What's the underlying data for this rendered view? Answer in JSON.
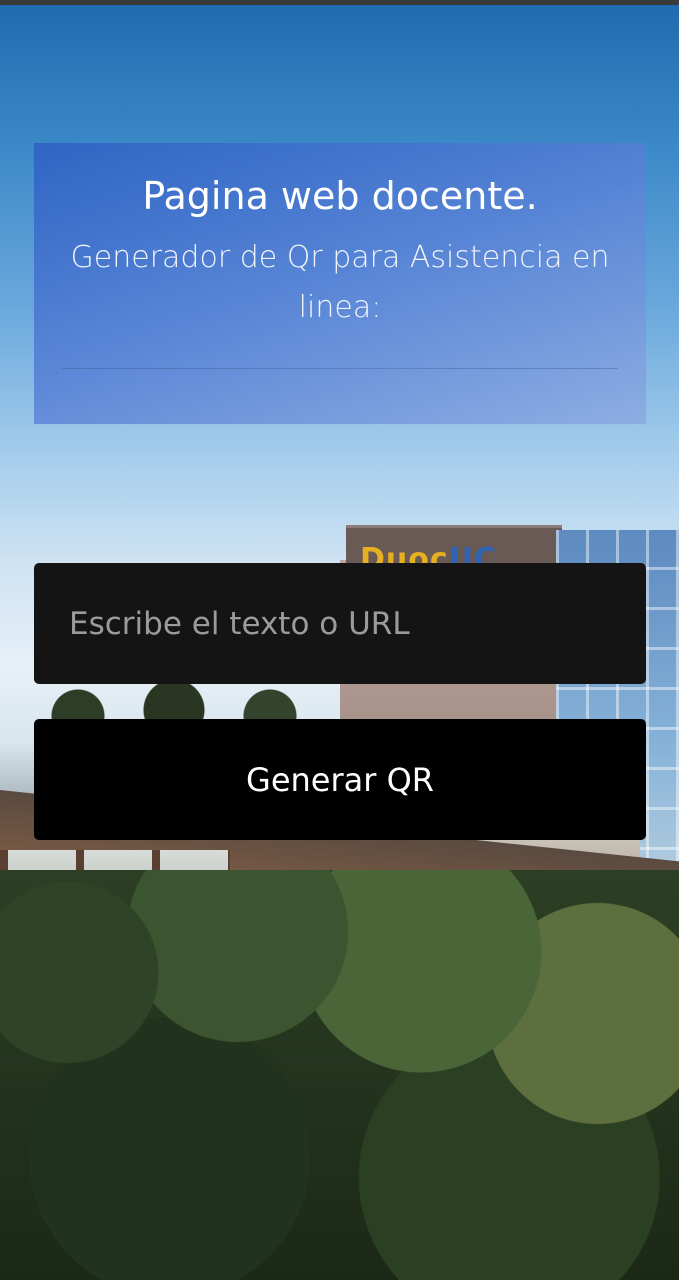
{
  "header": {
    "title": "Pagina web docente.",
    "subtitle": "Generador de Qr para Asistencia en linea:"
  },
  "form": {
    "input_placeholder": "Escribe el texto o URL",
    "input_value": "",
    "button_label": "Generar QR"
  },
  "background": {
    "sign_text_primary": "Duoc",
    "sign_text_secondary": "UC"
  },
  "colors": {
    "header_card": "#4a7ad0",
    "input_background": "#141414",
    "button_background": "#000000",
    "placeholder_text": "#9b9b9b"
  }
}
